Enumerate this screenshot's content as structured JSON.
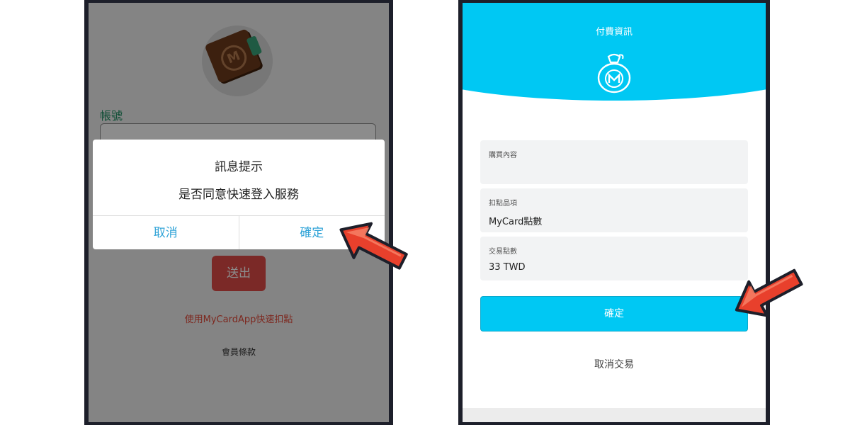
{
  "left_screen": {
    "account_label": "帳號",
    "submit_label": "送出",
    "quick_link": "使用MyCardApp快速扣點",
    "terms_link": "會員條款",
    "dialog": {
      "title": "訊息提示",
      "message": "是否同意快速登入服務",
      "cancel_label": "取消",
      "confirm_label": "確定"
    }
  },
  "right_screen": {
    "header_title": "付費資訊",
    "fields": [
      {
        "label": "購買內容",
        "value": ""
      },
      {
        "label": "扣點品項",
        "value": "MyCard點數"
      },
      {
        "label": "交易點數",
        "value": "33 TWD"
      }
    ],
    "confirm_label": "確定",
    "cancel_label": "取消交易"
  },
  "colors": {
    "accent_blue": "#00c8f3",
    "dialog_button": "#2fa3d7",
    "submit_red": "#e04b47",
    "arrow_red": "#e8402c",
    "label_green": "#198d5f"
  },
  "icons": {
    "logo": "wallet-icon",
    "header_icon": "money-bag-icon",
    "pointer": "arrow-pointer-icon"
  }
}
